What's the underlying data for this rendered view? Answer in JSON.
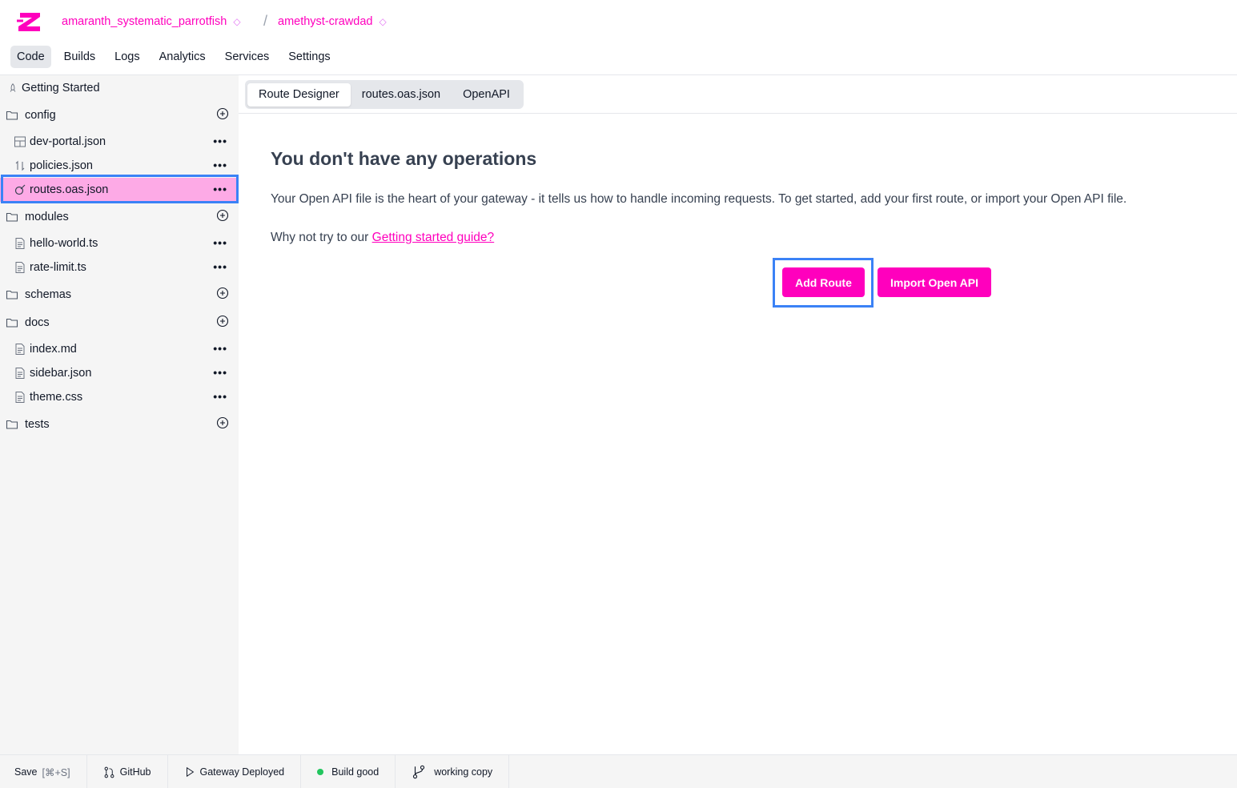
{
  "colors": {
    "brand": "#ff00bd",
    "selected_bg": "#fdaae6",
    "highlight": "#3b82f6",
    "build_good": "#22c55e"
  },
  "header": {
    "project": "amaranth_systematic_parrotfish",
    "environment": "amethyst-crawdad",
    "separator": "/"
  },
  "nav": [
    "Code",
    "Builds",
    "Logs",
    "Analytics",
    "Services",
    "Settings"
  ],
  "sidebar": {
    "getting_started": "Getting Started",
    "items": [
      {
        "type": "folder",
        "label": "config",
        "icon": "folder-icon"
      },
      {
        "type": "file",
        "label": "dev-portal.json",
        "icon": "layout-icon"
      },
      {
        "type": "file",
        "label": "policies.json",
        "icon": "arrows-up-down-icon"
      },
      {
        "type": "file",
        "label": "routes.oas.json",
        "icon": "route-icon",
        "selected": true
      },
      {
        "type": "folder",
        "label": "modules",
        "icon": "folder-icon"
      },
      {
        "type": "file",
        "label": "hello-world.ts",
        "icon": "file-icon"
      },
      {
        "type": "file",
        "label": "rate-limit.ts",
        "icon": "file-icon"
      },
      {
        "type": "folder",
        "label": "schemas",
        "icon": "folder-icon"
      },
      {
        "type": "folder",
        "label": "docs",
        "icon": "folder-icon"
      },
      {
        "type": "file",
        "label": "index.md",
        "icon": "file-icon"
      },
      {
        "type": "file",
        "label": "sidebar.json",
        "icon": "file-icon"
      },
      {
        "type": "file",
        "label": "theme.css",
        "icon": "file-icon"
      },
      {
        "type": "folder",
        "label": "tests",
        "icon": "folder-icon"
      }
    ],
    "more": "•••"
  },
  "tabs": [
    "Route Designer",
    "routes.oas.json",
    "OpenAPI"
  ],
  "main": {
    "heading": "You don't have any operations",
    "description": "Your Open API file is the heart of your gateway - it tells us how to handle incoming requests. To get started, add your first route, or import your Open API file.",
    "why_prefix": "Why not try to our ",
    "why_link": "Getting started guide?",
    "add_route": "Add Route",
    "import_openapi": "Import Open API"
  },
  "status": {
    "save": "Save",
    "save_shortcut": "[⌘+S]",
    "github": "GitHub",
    "gateway": "Gateway Deployed",
    "build": "Build good",
    "branch": "working copy"
  }
}
